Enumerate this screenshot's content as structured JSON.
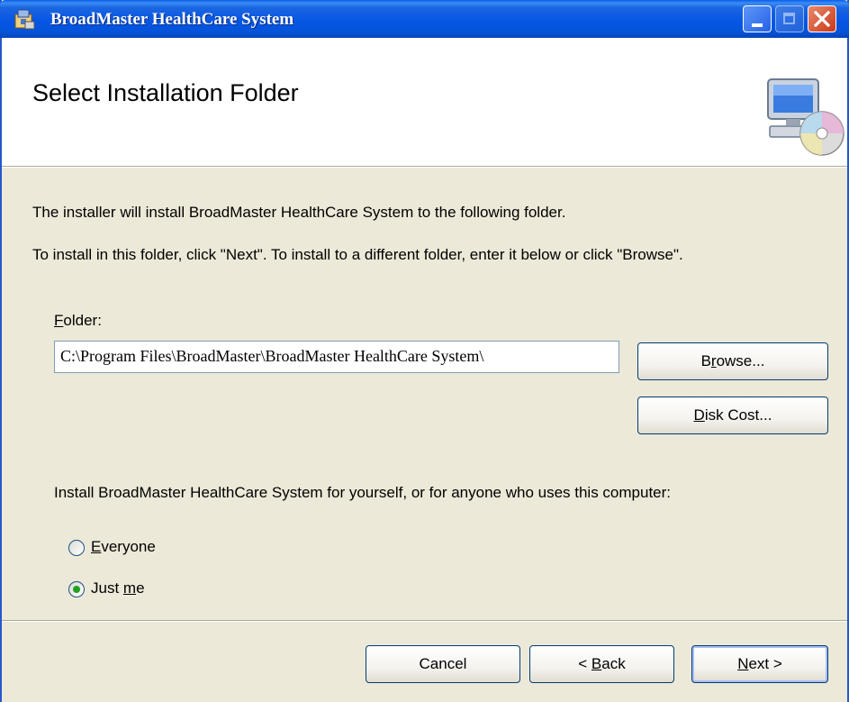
{
  "window": {
    "title": "BroadMaster HealthCare System"
  },
  "banner": {
    "title": "Select Installation Folder",
    "icon": "computer-cd-icon"
  },
  "body": {
    "intro_line": "The installer will install BroadMaster HealthCare System to the following folder.",
    "instruction_line": "To install in this folder, click \"Next\". To install to a different folder, enter it below or click \"Browse\"."
  },
  "folder": {
    "label_accel": "F",
    "label_rest": "older:",
    "value": "C:\\Program Files\\BroadMaster\\BroadMaster HealthCare System\\"
  },
  "buttons": {
    "browse_pre": "B",
    "browse_accel": "r",
    "browse_post": "owse...",
    "disk_cost_accel": "D",
    "disk_cost_post": "isk Cost...",
    "cancel": "Cancel",
    "back_pre": "< ",
    "back_accel": "B",
    "back_post": "ack",
    "next_accel": "N",
    "next_post": "ext >"
  },
  "install_for": {
    "question": "Install BroadMaster HealthCare System for yourself, or for anyone who uses this computer:",
    "options": [
      {
        "accel": "E",
        "rest": "veryone",
        "selected": false
      },
      {
        "pre": "Just ",
        "accel": "m",
        "rest": "e",
        "selected": true
      }
    ]
  },
  "colors": {
    "titlebar": "#0656e4",
    "dialog_bg": "#ece9d8",
    "radio_dot": "#21a121"
  }
}
